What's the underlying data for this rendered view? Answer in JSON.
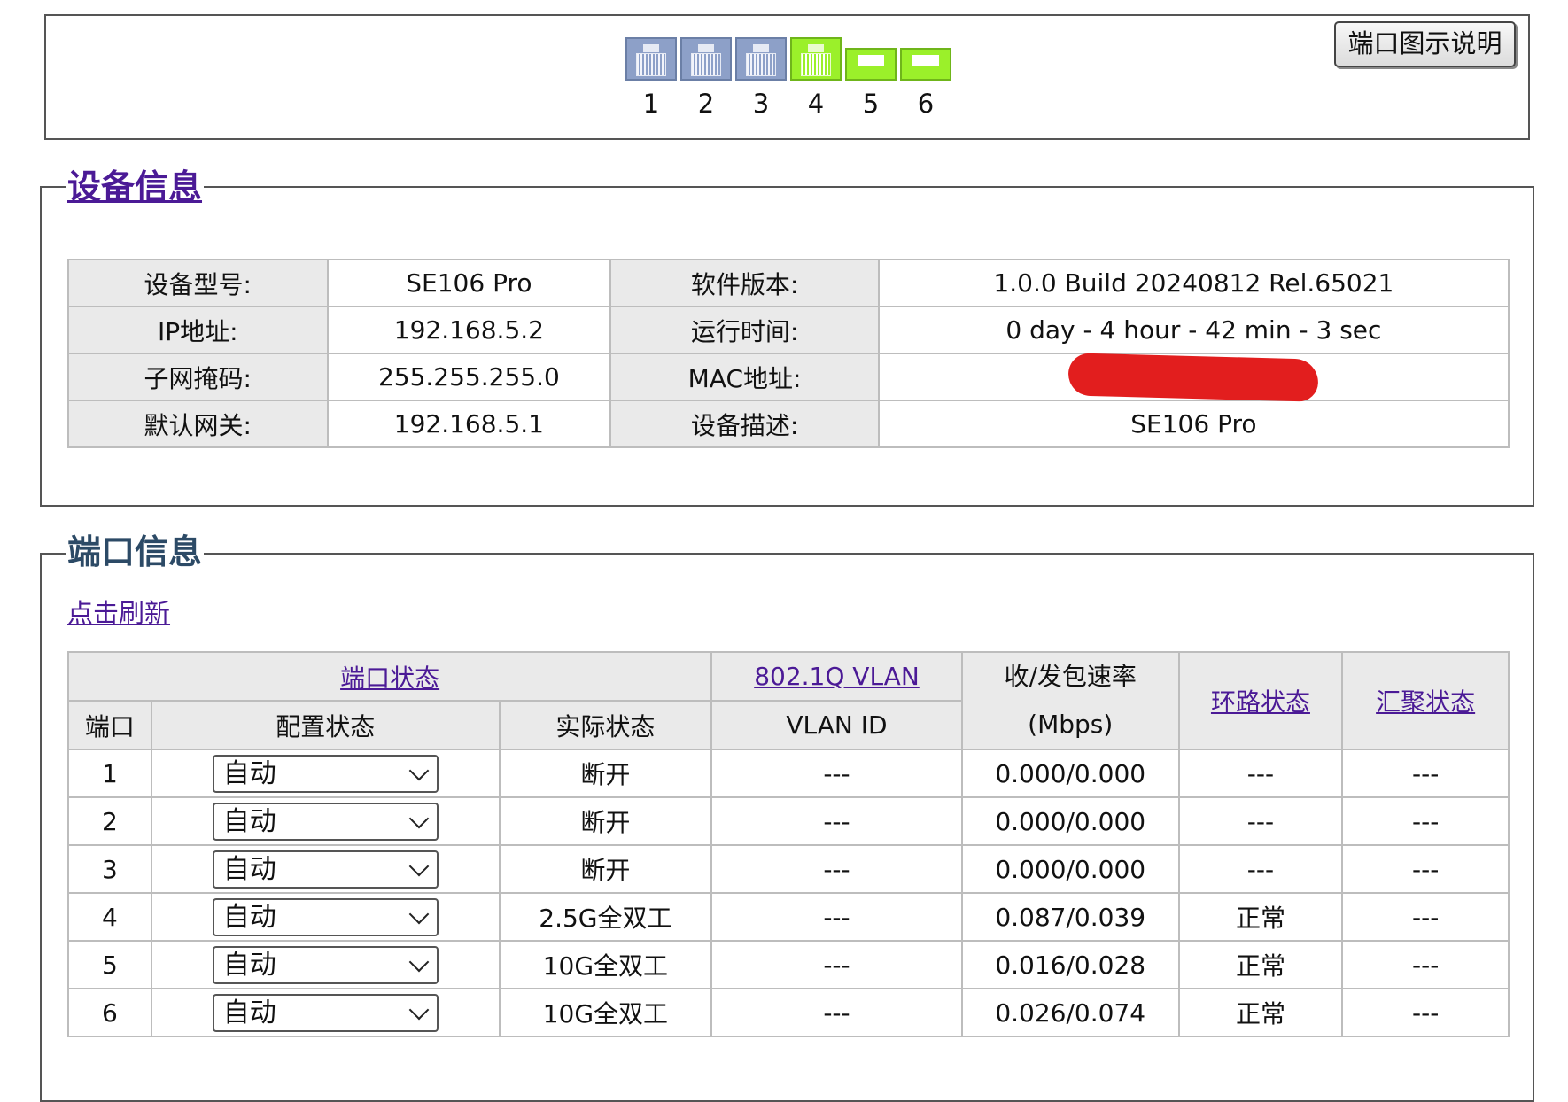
{
  "port_panel": {
    "legend_button": "端口图示说明",
    "ports": [
      {
        "num": "1",
        "icon": "rj45-port-icon",
        "status": "off"
      },
      {
        "num": "2",
        "icon": "rj45-port-icon",
        "status": "off"
      },
      {
        "num": "3",
        "icon": "rj45-port-icon",
        "status": "off"
      },
      {
        "num": "4",
        "icon": "rj45-port-icon",
        "status": "on"
      },
      {
        "num": "5",
        "icon": "sfp-port-icon",
        "status": "on"
      },
      {
        "num": "6",
        "icon": "sfp-port-icon",
        "status": "on"
      }
    ],
    "colors": {
      "port_off": "#8da0c8",
      "port_on": "#9bf02a"
    }
  },
  "device_info": {
    "legend": "设备信息",
    "rows": [
      {
        "l1": "设备型号:",
        "v1": "SE106 Pro",
        "l2": "软件版本:",
        "v2": "1.0.0 Build 20240812 Rel.65021"
      },
      {
        "l1": "IP地址:",
        "v1": "192.168.5.2",
        "l2": "运行时间:",
        "v2": "0 day - 4 hour - 42 min - 3 sec"
      },
      {
        "l1": "子网掩码:",
        "v1": "255.255.255.0",
        "l2": "MAC地址:",
        "v2": ""
      },
      {
        "l1": "默认网关:",
        "v1": "192.168.5.1",
        "l2": "设备描述:",
        "v2": "SE106 Pro"
      }
    ]
  },
  "port_info": {
    "legend": "端口信息",
    "refresh": "点击刷新",
    "headers": {
      "port_status": "端口状态",
      "vlan": "802.1Q VLAN",
      "rate_line1": "收/发包速率",
      "rate_line2": "(Mbps)",
      "loop": "环路状态",
      "aggregation": "汇聚状态",
      "port": "端口",
      "config": "配置状态",
      "actual": "实际状态",
      "vlan_id": "VLAN ID"
    },
    "rows": [
      {
        "port": "1",
        "config": "自动",
        "actual": "断开",
        "vlan_id": "---",
        "rate": "0.000/0.000",
        "loop": "---",
        "agg": "---"
      },
      {
        "port": "2",
        "config": "自动",
        "actual": "断开",
        "vlan_id": "---",
        "rate": "0.000/0.000",
        "loop": "---",
        "agg": "---"
      },
      {
        "port": "3",
        "config": "自动",
        "actual": "断开",
        "vlan_id": "---",
        "rate": "0.000/0.000",
        "loop": "---",
        "agg": "---"
      },
      {
        "port": "4",
        "config": "自动",
        "actual": "2.5G全双工",
        "vlan_id": "---",
        "rate": "0.087/0.039",
        "loop": "正常",
        "agg": "---"
      },
      {
        "port": "5",
        "config": "自动",
        "actual": "10G全双工",
        "vlan_id": "---",
        "rate": "0.016/0.028",
        "loop": "正常",
        "agg": "---"
      },
      {
        "port": "6",
        "config": "自动",
        "actual": "10G全双工",
        "vlan_id": "---",
        "rate": "0.026/0.074",
        "loop": "正常",
        "agg": "---"
      }
    ]
  }
}
